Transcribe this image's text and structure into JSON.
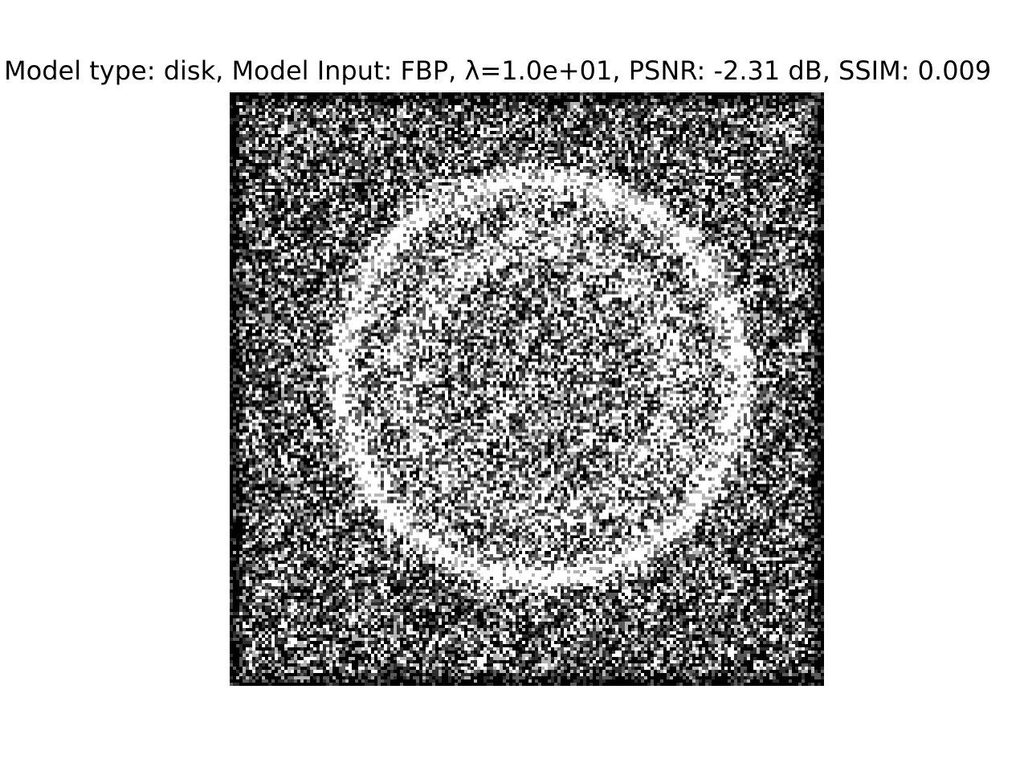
{
  "figure": {
    "title": "Model type: disk, Model Input: FBP, λ=1.0e+01, PSNR: -2.31 dB, SSIM: 0.009"
  },
  "image": {
    "kind": "grayscale-reconstruction",
    "content": "noisy white speckle texture with faint circular outline",
    "colors": {
      "background": "#ffffff",
      "dark": "#000000",
      "light": "#ffffff"
    }
  }
}
